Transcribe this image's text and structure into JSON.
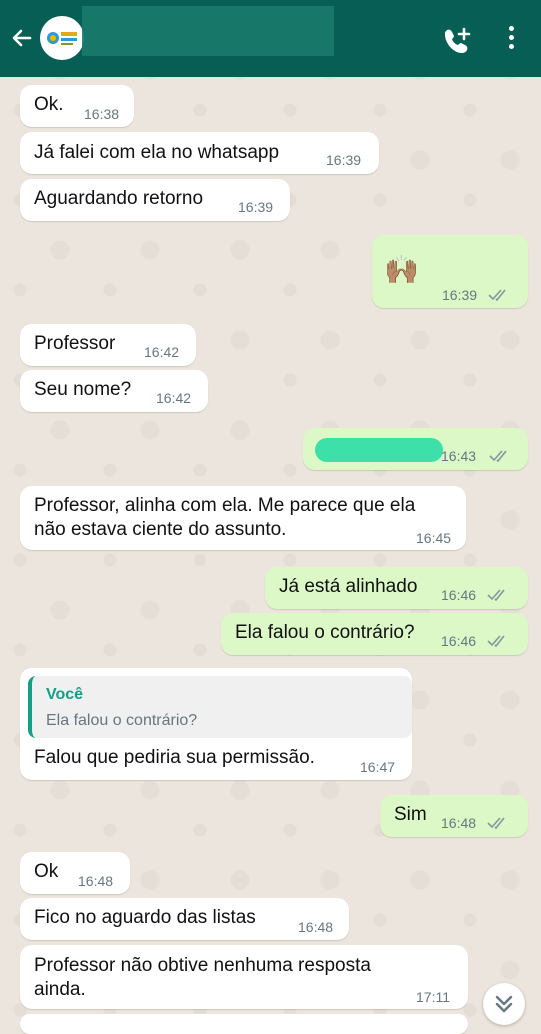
{
  "header": {
    "back_icon": "arrow-left-icon",
    "call_icon": "add-call-icon",
    "menu_icon": "more-vertical-icon",
    "colors": {
      "bar": "#075e54"
    }
  },
  "messages": [
    {
      "dir": "in",
      "text": "Ok.",
      "time": "16:38"
    },
    {
      "dir": "in",
      "text": "Já falei com ela no whatsapp",
      "time": "16:39"
    },
    {
      "dir": "in",
      "text": "Aguardando retorno",
      "time": "16:39"
    },
    {
      "dir": "out",
      "text": "🙌🏽",
      "time": "16:39"
    },
    {
      "dir": "in",
      "text": "Professor",
      "time": "16:42"
    },
    {
      "dir": "in",
      "text": "Seu nome?",
      "time": "16:42"
    },
    {
      "dir": "out",
      "text": "",
      "time": "16:43"
    },
    {
      "dir": "in",
      "text_line1": "Professor, alinha com ela. Me parece que ela",
      "text_line2": "não estava ciente do assunto.",
      "time": "16:45"
    },
    {
      "dir": "out",
      "text": "Já está alinhado",
      "time": "16:46"
    },
    {
      "dir": "out",
      "text": "Ela falou o contrário?",
      "time": "16:46"
    },
    {
      "dir": "in",
      "quote_author": "Você",
      "quote_text": "Ela falou o contrário?",
      "text": "Falou que pediria sua permissão.",
      "time": "16:47"
    },
    {
      "dir": "out",
      "text": "Sim",
      "time": "16:48"
    },
    {
      "dir": "in",
      "text": "Ok",
      "time": "16:48"
    },
    {
      "dir": "in",
      "text": "Fico no aguardo das listas",
      "time": "16:48"
    },
    {
      "dir": "in",
      "text_line1": "Professor não obtive nenhuma resposta",
      "text_line2": "ainda.",
      "time": "17:11"
    }
  ],
  "scroll_icon": "double-chevron-down-icon",
  "colors": {
    "incoming": "#ffffff",
    "outgoing": "#dcf8c6",
    "ticks": "#8696a0",
    "quote_accent": "#15a085"
  }
}
